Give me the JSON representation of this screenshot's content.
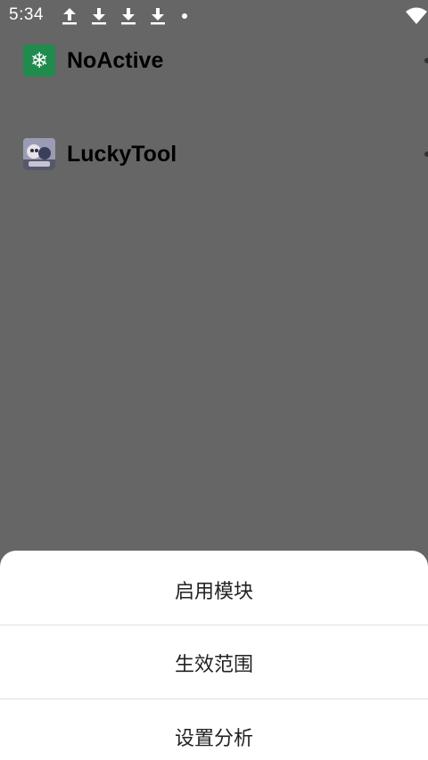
{
  "status_bar": {
    "time": "5:34",
    "icons": [
      "upload-arrow-icon",
      "download-arrow-icon",
      "download-arrow-icon",
      "download-arrow-icon",
      "notification-dot-icon",
      "wifi-icon"
    ]
  },
  "modules": [
    {
      "name": "NoActive",
      "icon": "snowflake-icon",
      "icon_glyph": "❄",
      "icon_color": "#1f8b4c"
    },
    {
      "name": "LuckyTool",
      "icon": "luckytool-app-icon"
    }
  ],
  "bottom_sheet": {
    "options": [
      {
        "label": "启用模块"
      },
      {
        "label": "生效范围"
      },
      {
        "label": "设置分析"
      }
    ]
  },
  "colors": {
    "scrim": "#666666",
    "sheet": "#ffffff"
  }
}
